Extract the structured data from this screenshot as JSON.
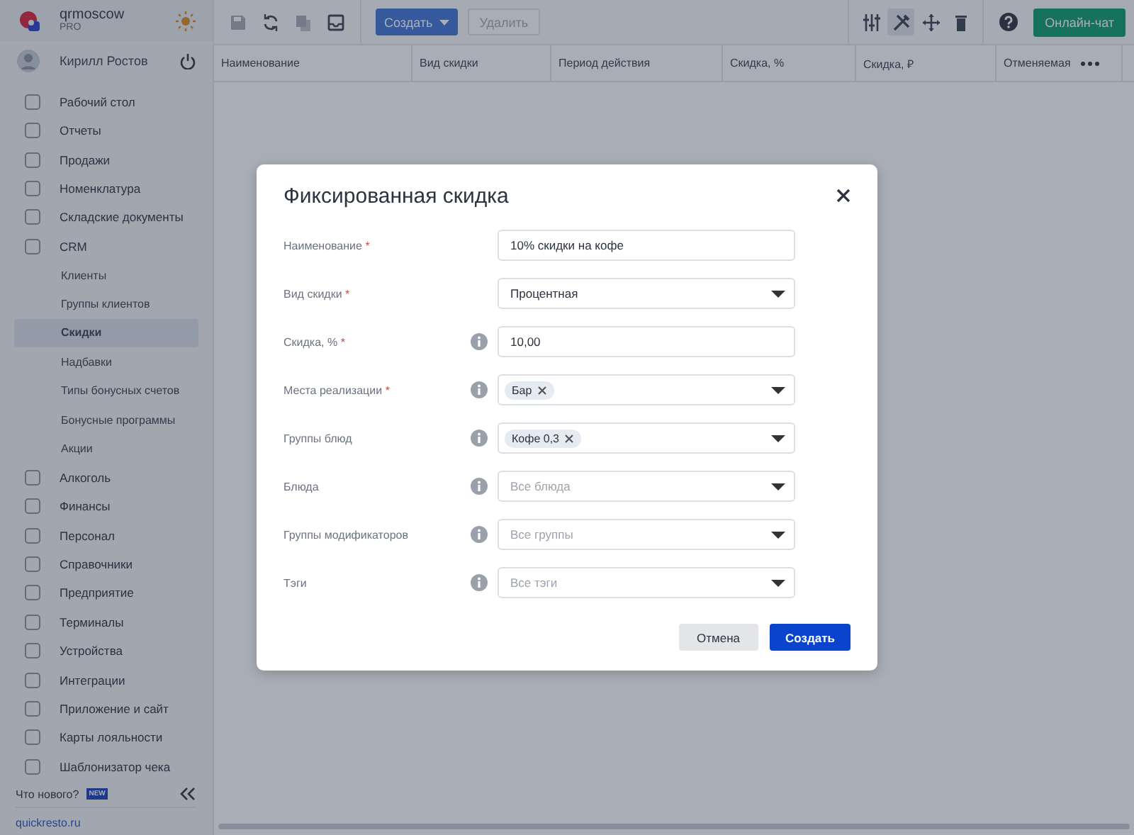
{
  "brand": {
    "name": "qrmoscow",
    "plan": "PRO"
  },
  "user": {
    "name": "Кирилл Ростов"
  },
  "sidebar": {
    "items": [
      {
        "label": "Рабочий стол",
        "selected": false
      },
      {
        "label": "Отчеты",
        "selected": false
      },
      {
        "label": "Продажи",
        "selected": false
      },
      {
        "label": "Номенклатура",
        "selected": false
      },
      {
        "label": "Складские документы",
        "selected": false
      },
      {
        "label": "CRM",
        "selected": false,
        "expanded": true,
        "children": [
          {
            "label": "Клиенты",
            "selected": false
          },
          {
            "label": "Группы клиентов",
            "selected": false
          },
          {
            "label": "Скидки",
            "selected": true
          },
          {
            "label": "Надбавки",
            "selected": false
          },
          {
            "label": "Типы бонусных счетов",
            "selected": false
          },
          {
            "label": "Бонусные программы",
            "selected": false
          },
          {
            "label": "Акции",
            "selected": false
          }
        ]
      },
      {
        "label": "Алкоголь",
        "selected": false
      },
      {
        "label": "Финансы",
        "selected": false
      },
      {
        "label": "Персонал",
        "selected": false
      },
      {
        "label": "Справочники",
        "selected": false
      },
      {
        "label": "Предприятие",
        "selected": false
      },
      {
        "label": "Терминалы",
        "selected": false
      },
      {
        "label": "Устройства",
        "selected": false
      },
      {
        "label": "Интеграции",
        "selected": false
      },
      {
        "label": "Приложение и сайт",
        "selected": false
      },
      {
        "label": "Карты лояльности",
        "selected": false
      },
      {
        "label": "Шаблонизатор чека",
        "selected": false
      }
    ],
    "whats_new": "Что нового?",
    "new_badge": "NEW",
    "site_link": "quickresto.ru"
  },
  "toolbar": {
    "left_tools": [
      {
        "disabled": true
      },
      {
        "disabled": false
      },
      {
        "disabled": true
      },
      {
        "disabled": false
      }
    ],
    "create_button": "Создать",
    "delete_button": {
      "label": "Удалить",
      "disabled": true
    },
    "right_tools": [
      {
        "selected": false
      },
      {
        "selected": true
      },
      {
        "selected": false
      },
      {
        "selected": false
      }
    ],
    "chat_button": "Онлайн-чат"
  },
  "table": {
    "columns": [
      "Наименование",
      "Вид скидки",
      "Период действия",
      "Скидка, %",
      "Скидка, ₽",
      "Отменяемая"
    ]
  },
  "dialog": {
    "title": "Фиксированная скидка",
    "fields": [
      {
        "kind": "text",
        "label": "Наименование",
        "required": true,
        "info": false,
        "value": "10% скидки на кофе"
      },
      {
        "kind": "select",
        "label": "Вид скидки",
        "required": true,
        "info": false,
        "value": "Процентная"
      },
      {
        "kind": "text",
        "label": "Скидка, %",
        "required": true,
        "info": true,
        "value": "10,00"
      },
      {
        "kind": "multiselect",
        "label": "Места реализации",
        "required": true,
        "info": true,
        "tags": [
          "Бар"
        ]
      },
      {
        "kind": "multiselect",
        "label": "Группы блюд",
        "required": false,
        "info": true,
        "tags": [
          "Кофе 0,3"
        ]
      },
      {
        "kind": "select",
        "label": "Блюда",
        "required": false,
        "info": true,
        "placeholder": "Все блюда"
      },
      {
        "kind": "select",
        "label": "Группы модификаторов",
        "required": false,
        "info": true,
        "placeholder": "Все группы"
      },
      {
        "kind": "select",
        "label": "Тэги",
        "required": false,
        "info": true,
        "placeholder": "Все тэги"
      }
    ],
    "required_mark": "*",
    "cancel_button": "Отмена",
    "submit_button": "Создать"
  }
}
